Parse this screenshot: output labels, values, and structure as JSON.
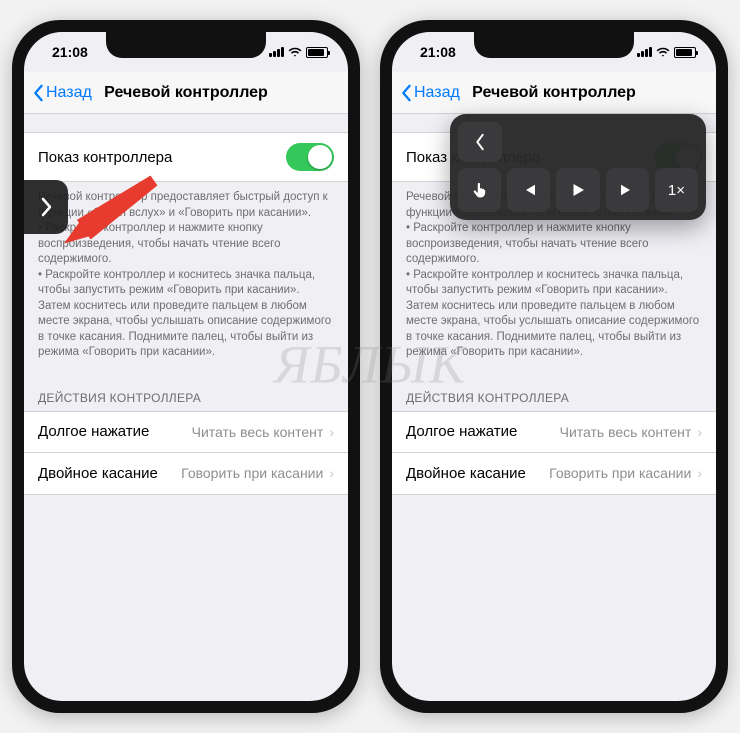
{
  "statusTime": "21:08",
  "nav": {
    "back": "Назад",
    "title": "Речевой контроллер"
  },
  "toggleRow": {
    "label": "Показ контроллера"
  },
  "helpText": "Речевой контроллер предоставляет быстрый доступ к функции «Экран вслух» и «Говорить при касании».\n • Раскройте контроллер и нажмите кнопку воспроизведения, чтобы начать чтение всего содержимого.\n • Раскройте контроллер и коснитесь значка пальца, чтобы запустить режим «Говорить при касании». Затем коснитесь или проведите пальцем в любом месте экрана, чтобы услышать описание содержимого в точке касания. Поднимите палец, чтобы выйти из режима «Говорить при касании».",
  "sectionHeader": "ДЕЙСТВИЯ КОНТРОЛЛЕРА",
  "actions": [
    {
      "label": "Долгое нажатие",
      "value": "Читать весь контент"
    },
    {
      "label": "Двойное касание",
      "value": "Говорить при касании"
    }
  ],
  "panel": {
    "speed": "1×"
  },
  "watermark": "ЯБЛЫК"
}
